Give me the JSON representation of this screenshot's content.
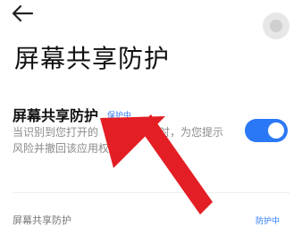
{
  "header": {
    "back_icon": "back-arrow-icon",
    "title": "屏幕共享防护",
    "help_icon": "help-circle-icon"
  },
  "setting": {
    "title": "屏幕共享防护",
    "status": "保护中",
    "description_line1": "当识别到您打开的",
    "description_line1_tail": "存在风险时，为您提示",
    "description_line2": "风险并撤回该应用权",
    "toggle_on": true,
    "toggle_color": "#2b78f6"
  },
  "row": {
    "label": "屏幕共享防护",
    "value": "防护中"
  },
  "annotation": {
    "arrow_color": "#e31e24"
  }
}
